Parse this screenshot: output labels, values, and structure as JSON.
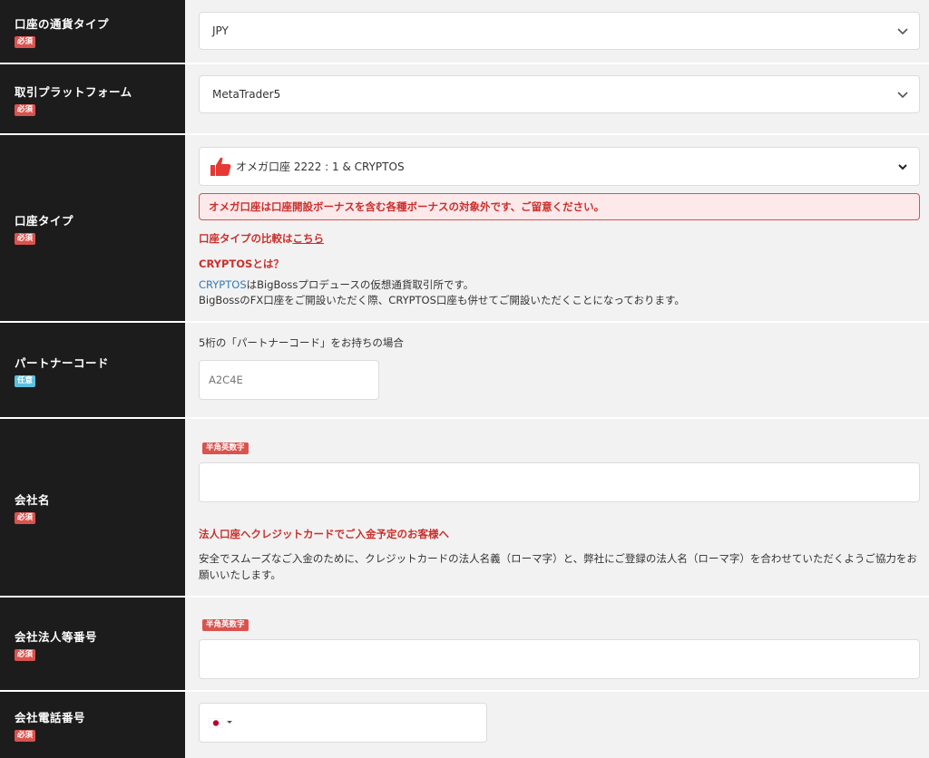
{
  "required_label": "必須",
  "optional_label": "任意",
  "alnum_tag": "半角英数字",
  "currency": {
    "label": "口座の通貨タイプ",
    "value": "JPY"
  },
  "platform": {
    "label": "取引プラットフォーム",
    "value": "MetaTrader5"
  },
  "account_type": {
    "label": "口座タイプ",
    "value": "オメガ口座 2222 : 1 & CRYPTOS",
    "alert": "オメガ口座は口座開設ボーナスを含む各種ボーナスの対象外です、ご留意ください。",
    "compare_text": "口座タイプの比較は",
    "compare_link": "こちら",
    "cryptos_heading": "CRYPTOSとは？",
    "cryptos_link": "CRYPTOS",
    "cryptos_desc1": "はBigBossプロデュースの仮想通貨取引所です。",
    "cryptos_desc2": "BigBossのFX口座をご開設いただく際、CRYPTOS口座も併せてご開設いただくことになっております。"
  },
  "partner": {
    "label": "パートナーコード",
    "note": "5桁の「パートナーコード」をお持ちの場合",
    "placeholder": "A2C4E"
  },
  "company_name": {
    "label": "会社名",
    "notice_heading": "法人口座へクレジットカードでご入金予定のお客様へ",
    "notice_text": "安全でスムーズなご入金のために、クレジットカードの法人名義（ローマ字）と、弊社にご登録の法人名（ローマ字）を合わせていただくようご協力をお願いいたします。"
  },
  "company_number": {
    "label": "会社法人等番号"
  },
  "company_phone": {
    "label": "会社電話番号"
  },
  "colors": {
    "accent_red": "#d9534f",
    "label_bg": "#1c1c1c",
    "link_blue": "#337ab7"
  }
}
